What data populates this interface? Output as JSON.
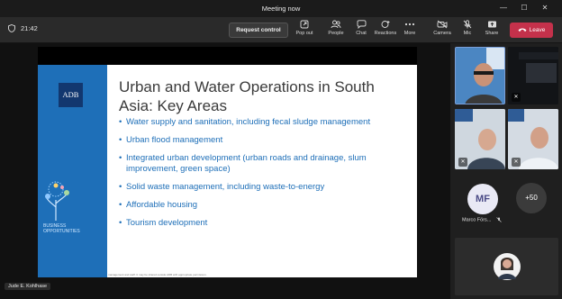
{
  "window": {
    "title": "Meeting now"
  },
  "toolbar": {
    "timer": "21:42",
    "request_control": "Request control",
    "pop_out": "Pop out",
    "people": "People",
    "chat": "Chat",
    "reactions": "Reactions",
    "more": "More",
    "camera": "Camera",
    "mic": "Mic",
    "share": "Share",
    "leave": "Leave"
  },
  "slide": {
    "logo_text": "ADB",
    "title": "Urban and Water Operations in South Asia: Key Areas",
    "bullets": [
      "Water supply and sanitation, including fecal sludge management",
      "Urban flood management",
      "Integrated urban development (urban roads and drainage, slum improvement, green space)",
      "Solid waste management, including waste-to-energy",
      "Affordable housing",
      "Tourism development"
    ],
    "business_line1": "BUSINESS",
    "business_line2": "OPPORTUNITIES",
    "footnote": "management and staff. It may be shared outside ADB with appropriate permission."
  },
  "presenter": {
    "name": "Jude E. Kohlhase"
  },
  "gallery": {
    "initials": "MF",
    "participant_name": "Marco Förs...",
    "more_count": "+50"
  },
  "colors": {
    "slide_blue": "#1e6fb8",
    "leave_red": "#c4314b",
    "adb_navy": "#12376f"
  }
}
